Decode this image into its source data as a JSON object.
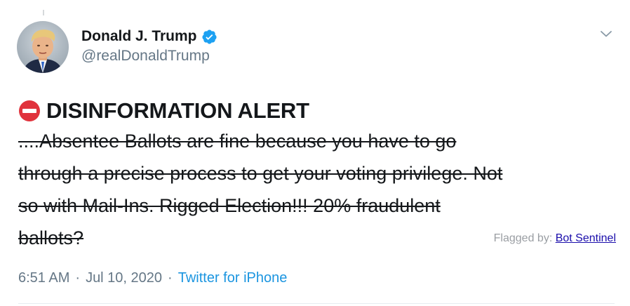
{
  "tweet": {
    "author": {
      "display_name": "Donald J. Trump",
      "handle": "@realDonaldTrump",
      "verified": true,
      "avatar_icon": "avatar-photo-icon"
    },
    "menu_icon": "chevron-down-icon",
    "alert": {
      "icon": "no-entry-icon",
      "text": "DISINFORMATION ALERT"
    },
    "body_lines": [
      "....Absentee Ballots are fine because you have to go",
      "through a precise process to get your voting privilege. Not",
      "so with Mail-Ins. Rigged Election!!! 20% fraudulent",
      "ballots?"
    ],
    "flag": {
      "label": "Flagged by:",
      "source": "Bot Sentinel"
    },
    "time": "6:51 AM",
    "date": "Jul 10, 2020",
    "separator": "·",
    "client": "Twitter for iPhone"
  },
  "colors": {
    "text_primary": "#14171a",
    "text_secondary": "#657786",
    "twitter_blue": "#1b95e0",
    "verified_blue": "#1da1f2",
    "alert_red": "#e0323c",
    "flag_link": "#1a0dab"
  }
}
